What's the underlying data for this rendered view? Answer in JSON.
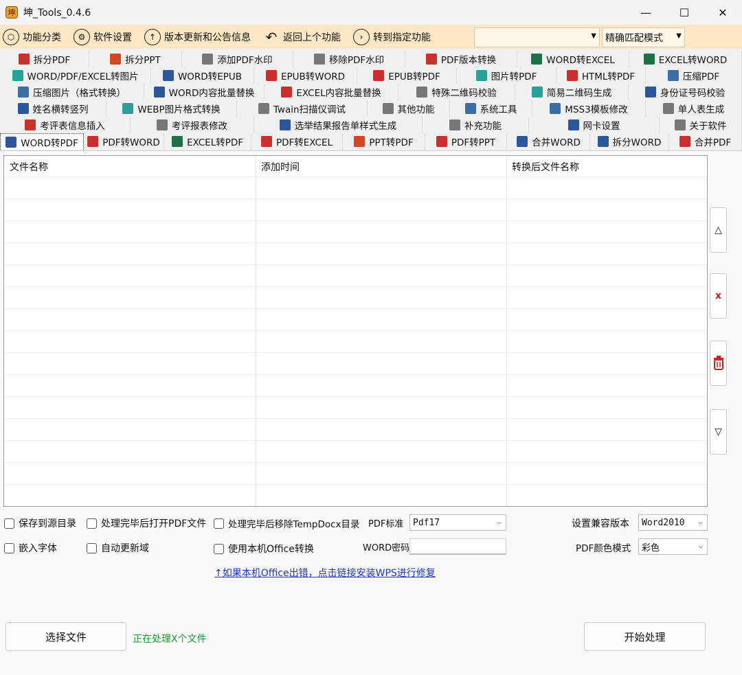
{
  "window": {
    "title": "坤_Tools_0.4.6",
    "minimize": "—",
    "maximize": "☐",
    "close": "✕"
  },
  "toolbar": {
    "items": [
      {
        "icon": "category-icon",
        "glyph": "⬡",
        "label": "功能分类"
      },
      {
        "icon": "gear-icon",
        "glyph": "⚙",
        "label": "软件设置"
      },
      {
        "icon": "arrow-up-circle-icon",
        "glyph": "↑",
        "label": "版本更新和公告信息"
      },
      {
        "icon": "back-arrow-icon",
        "glyph": "↶",
        "label": "返回上个功能"
      },
      {
        "icon": "arrow-right-circle-icon",
        "glyph": "›",
        "label": "转到指定功能"
      }
    ],
    "search_value": "",
    "mode_value": "精确匹配模式"
  },
  "tab_rows": [
    [
      "拆分PDF",
      "拆分PPT",
      "添加PDF水印",
      "移除PDF水印",
      "PDF版本转换",
      "WORD转EXCEL",
      "EXCEL转WORD"
    ],
    [
      "WORD/PDF/EXCEL转图片",
      "WORD转EPUB",
      "EPUB转WORD",
      "EPUB转PDF",
      "图片转PDF",
      "HTML转PDF",
      "压缩PDF"
    ],
    [
      "压缩图片（格式转换）",
      "WORD内容批量替换",
      "EXCEL内容批量替换",
      "特殊二维码校验",
      "简易二维码生成",
      "身份证号码校验"
    ],
    [
      "姓名横转竖列",
      "WEBP图片格式转换",
      "Twain扫描仪调试",
      "其他功能",
      "系统工具",
      "MSS3模板修改",
      "单人表生成"
    ],
    [
      "考评表信息插入",
      "考评报表修改",
      "选举结果报告单样式生成",
      "补充功能",
      "网卡设置",
      "关于软件"
    ],
    [
      "WORD转PDF",
      "PDF转WORD",
      "EXCEL转PDF",
      "PDF转EXCEL",
      "PPT转PDF",
      "PDF转PPT",
      "合并WORD",
      "拆分WORD",
      "合并PDF"
    ]
  ],
  "tab_icon_colors": {
    "pdf": "#c9302c",
    "word": "#2b579a",
    "excel": "#1e7145",
    "ppt": "#d24726",
    "img": "#2aa198",
    "gear": "#3a6ea5",
    "misc": "#777777"
  },
  "grid": {
    "headers": [
      "文件名称",
      "添加时间",
      "转换后文件名称"
    ],
    "rows": []
  },
  "side_buttons": {
    "up": "△",
    "delete": "x",
    "clear": "🗑",
    "down": "▽"
  },
  "options": {
    "save_to_source": "保存到源目录",
    "open_pdf_after": "处理完毕后打开PDF文件",
    "remove_temp": "处理完毕后移除TempDocx目录",
    "embed_fonts": "嵌入字体",
    "auto_update_fields": "自动更新域",
    "use_office": "使用本机Office转换",
    "pdf_standard_label": "PDF标准",
    "pdf_standard_value": "Pdf17",
    "compat_label": "设置兼容版本",
    "compat_value": "Word2010",
    "word_password_label": "WORD密码",
    "word_password_value": "",
    "color_mode_label": "PDF颜色模式",
    "color_mode_value": "彩色"
  },
  "repair_link": "↑如果本机Office出错，点击链接安装WPS进行修复",
  "buttons": {
    "select_files": "选择文件",
    "start": "开始处理"
  },
  "status_text": "正在处理X个文件"
}
